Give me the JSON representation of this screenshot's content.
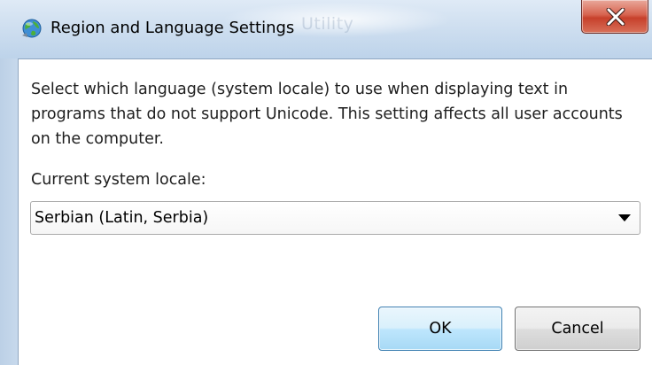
{
  "window": {
    "title": "Region and Language Settings",
    "background_title_text": "Utility",
    "icon": "globe-icon",
    "close_icon": "close-icon",
    "accent_close": "#c7402b"
  },
  "content": {
    "description": "Select which language (system locale) to use when displaying text in programs that do not support Unicode. This setting affects all user accounts on the computer.",
    "locale_label": "Current system locale:",
    "locale_value": "Serbian (Latin, Serbia)"
  },
  "buttons": {
    "ok_label": "OK",
    "cancel_label": "Cancel"
  }
}
